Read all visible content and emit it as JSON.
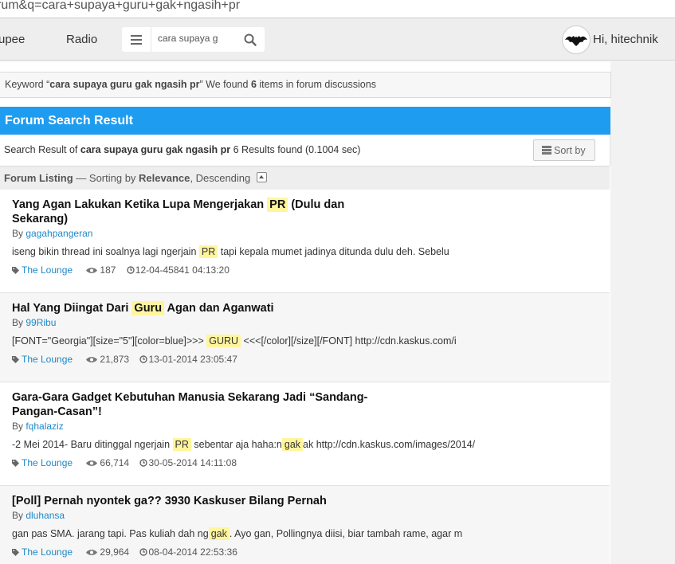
{
  "browser": {
    "url": "rum&q=cara+supaya+guru+gak+ngasih+pr"
  },
  "nav": {
    "links": [
      "upee",
      "Radio"
    ],
    "search_value": "cara supaya g",
    "user_greeting": "Hi, hitechnik"
  },
  "keyword_notice": {
    "prefix": "Keyword “",
    "keyword": "cara supaya guru gak ngasih pr",
    "middle": "” We found ",
    "count": "6",
    "suffix": " items in forum discussions"
  },
  "section_header": "Forum Search Result",
  "result_summary": {
    "prefix": "Search Result of ",
    "query": "cara supaya guru gak ngasih pr",
    "suffix": " 6 Results found (0.1004 sec)",
    "sort_label": "Sort by"
  },
  "listing": {
    "label": "Forum Listing",
    "sorting_prefix": " — Sorting by ",
    "sort_field": "Relevance",
    "sort_order": ", Descending"
  },
  "results": [
    {
      "title_parts": [
        "Yang Agan Lakukan Ketika Lupa Mengerjakan ",
        "PR",
        " (Dulu dan Sekarang)"
      ],
      "by_label": "By ",
      "author": "gagahpangeran",
      "snippet_parts": [
        "iseng bikin thread ini soalnya lagi ngerjain ",
        "PR",
        " tapi kepala mumet jadinya ditunda dulu deh. Sebelu"
      ],
      "forum": "The Lounge",
      "views": "187",
      "date": "12-04-45841 04:13:20"
    },
    {
      "title_parts": [
        "Hal Yang Diingat Dari ",
        "Guru",
        " Agan dan Aganwati"
      ],
      "by_label": "By ",
      "author": "99Ribu",
      "snippet_parts": [
        "[FONT=\"Georgia\"][size=\"5\"][color=blue]>>> ",
        "GURU",
        " <<<[/color][/size][/FONT] http://cdn.kaskus.com/i"
      ],
      "forum": "The Lounge",
      "views": "21,873",
      "date": "13-01-2014 23:05:47"
    },
    {
      "title_parts": [
        "Gara-Gara Gadget Kebutuhan Manusia Sekarang Jadi “Sandang-Pangan-Casan”!"
      ],
      "by_label": "By ",
      "author": "fqhalaziz",
      "snippet_parts": [
        "-2 Mei 2014- Baru ditinggal ngerjain ",
        "PR",
        " sebentar aja haha:n",
        "gak",
        "ak http://cdn.kaskus.com/images/2014/"
      ],
      "forum": "The Lounge",
      "views": "66,714",
      "date": "30-05-2014 14:11:08"
    },
    {
      "title_parts": [
        "[Poll] Pernah nyontek ga?? 3930 Kaskuser Bilang Pernah"
      ],
      "by_label": "By ",
      "author": "dluhansa",
      "snippet_parts": [
        "gan pas SMA. jarang tapi. Pas kuliah dah ng",
        "gak",
        ". Ayo gan, Pollingnya diisi, biar tambah rame, agar m"
      ],
      "forum": "The Lounge",
      "views": "29,964",
      "date": "08-04-2014 22:53:36"
    }
  ]
}
